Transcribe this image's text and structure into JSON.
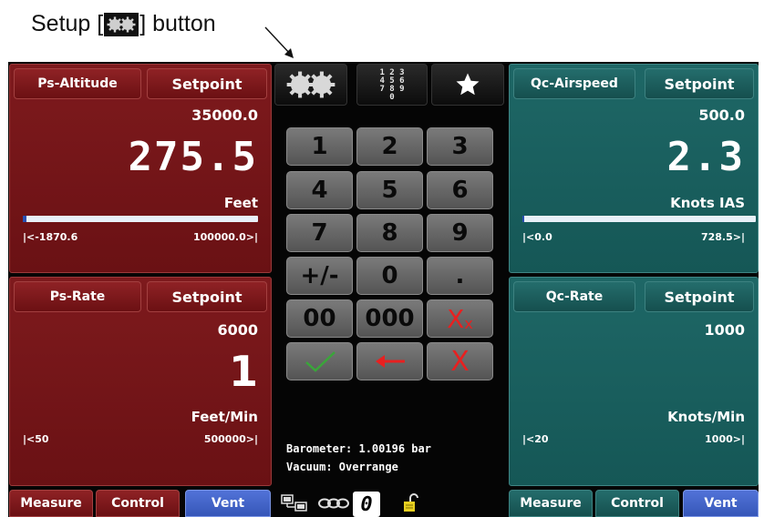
{
  "annotation": {
    "prefix": "Setup [",
    "suffix": "] button"
  },
  "left_top": {
    "tab_label": "Ps-Altitude",
    "setpoint_label": "Setpoint",
    "setpoint_value": "35000.0",
    "reading": "275.5",
    "units": "Feet",
    "range_min": "|<-1870.6",
    "range_max": "100000.0>|"
  },
  "left_bottom": {
    "tab_label": "Ps-Rate",
    "setpoint_label": "Setpoint",
    "setpoint_value": "6000",
    "reading": "1",
    "units": "Feet/Min",
    "range_min": "|<50",
    "range_max": "500000>|"
  },
  "right_top": {
    "tab_label": "Qc-Airspeed",
    "setpoint_label": "Setpoint",
    "setpoint_value": "500.0",
    "reading": "2.3",
    "units": "Knots IAS",
    "range_min": "|<0.0",
    "range_max": "728.5>|"
  },
  "right_bottom": {
    "tab_label": "Qc-Rate",
    "setpoint_label": "Setpoint",
    "setpoint_value": "1000",
    "units": "Knots/Min",
    "range_min": "|<20",
    "range_max": "1000>|"
  },
  "keypad": {
    "numpad_icon_text": "1 2 3\n4 5 6\n7 8 9\n0",
    "keys": [
      "1",
      "2",
      "3",
      "4",
      "5",
      "6",
      "7",
      "8",
      "9",
      "+/-",
      "0",
      ".",
      "00",
      "000"
    ],
    "clear_label": "X",
    "clear_sub": "x",
    "cancel_label": "X"
  },
  "status": {
    "barometer": "Barometer: 1.00196 bar",
    "vacuum": "Vacuum: Overrange",
    "zero_label": "0"
  },
  "bottom_left": {
    "measure": "Measure",
    "control": "Control",
    "vent": "Vent"
  },
  "bottom_right": {
    "measure": "Measure",
    "control": "Control",
    "vent": "Vent"
  },
  "colors": {
    "red_panel": "#6e1316",
    "teal_panel": "#185a59",
    "vent_blue": "#4262c8",
    "check_green": "#3aa53a",
    "arrow_red": "#e02020"
  }
}
